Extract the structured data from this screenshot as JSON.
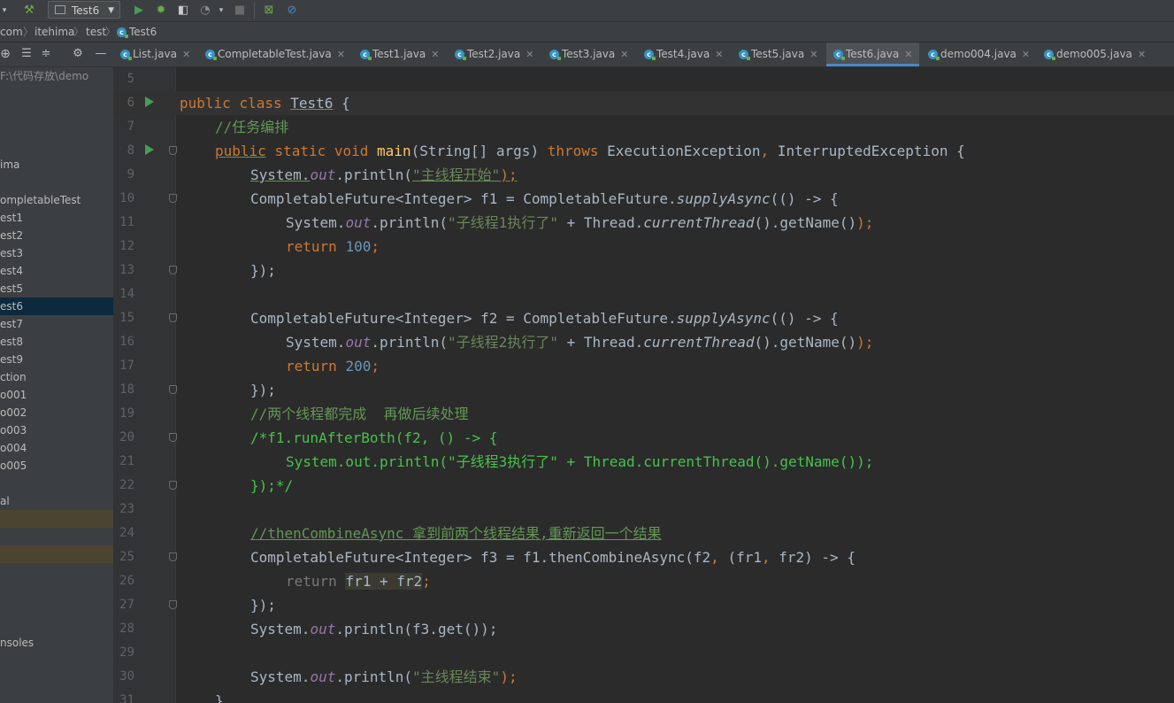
{
  "toolbar": {
    "run_config": "Test6"
  },
  "breadcrumb": [
    "com",
    "itehima",
    "test",
    "Test6"
  ],
  "tabs": [
    {
      "label": "List.java"
    },
    {
      "label": "CompletableTest.java"
    },
    {
      "label": "Test1.java"
    },
    {
      "label": "Test2.java"
    },
    {
      "label": "Test3.java"
    },
    {
      "label": "Test4.java"
    },
    {
      "label": "Test5.java"
    },
    {
      "label": "Test6.java",
      "active": true
    },
    {
      "label": "demo004.java"
    },
    {
      "label": "demo005.java"
    }
  ],
  "sidebar": {
    "path": "F:\\代码存放\\demo",
    "items": [
      {
        "label": "ima"
      },
      {
        "label": "ompletableTest"
      },
      {
        "label": "est1"
      },
      {
        "label": "est2"
      },
      {
        "label": "est3"
      },
      {
        "label": "est4"
      },
      {
        "label": "est5"
      },
      {
        "label": "est6"
      },
      {
        "label": "est7"
      },
      {
        "label": "est8"
      },
      {
        "label": "est9"
      },
      {
        "label": "ction"
      },
      {
        "label": "o001"
      },
      {
        "label": "o002"
      },
      {
        "label": "o003"
      },
      {
        "label": "o004"
      },
      {
        "label": "o005"
      },
      {
        "label": "al"
      },
      {
        "label": ""
      },
      {
        "label": ""
      },
      {
        "label": "nsoles"
      }
    ]
  },
  "editor": {
    "line_numbers": [
      "5",
      "6",
      "7",
      "8",
      "9",
      "10",
      "11",
      "12",
      "13",
      "14",
      "15",
      "16",
      "17",
      "18",
      "19",
      "20",
      "21",
      "22",
      "23",
      "24",
      "25",
      "26",
      "27",
      "28",
      "29",
      "30",
      "31"
    ],
    "text": {
      "l6_public": "public",
      "l6_class": "class",
      "l6_name": "Test6",
      "l6_brace": " {",
      "l7_comment": "//任务编排",
      "l8_public": "public",
      "l8_static": "static",
      "l8_void": "void",
      "l8_main": "main",
      "l8_params": "(String[] args) ",
      "l8_throws": "throws",
      "l8_ex1": " ExecutionException",
      "l8_comma": ",",
      "l8_ex2": " InterruptedException {",
      "sys": "System.",
      "out": "out",
      "println": ".println(",
      "l9_str": "\"主线程开始\"",
      "close_semi": ");",
      "l10_decl": "CompletableFuture<Integer> f1 = CompletableFuture.",
      "supply": "supplyAsync",
      "lambda_open": "(() -> {",
      "l11_str": "\"子线程1执行了\"",
      "plus_thread": " + Thread.",
      "cur": "currentThread",
      "getname": "().getName()",
      "semi_close": ");",
      "ret": "return",
      "l12_num": "100",
      "semi": ";",
      "close_block": "});",
      "l15_decl": "CompletableFuture<Integer> f2 = CompletableFuture.",
      "l16_str": "\"子线程2执行了\"",
      "l17_num": "200",
      "l19_comment": "//两个线程都完成  再做后续处理",
      "l20_comment": "/*f1.runAfterBoth(f2, () -> {",
      "l21_comment": "System.out.println(\"子线程3执行了\" + Thread.currentThread().getName());",
      "l22_comment": "});*/",
      "l24_comment": "//thenCombineAsync 拿到前两个线程结果,重新返回一个结果",
      "l25_decl": "CompletableFuture<Integer> f3 = f1.thenCombineAsync(f2",
      "l25_rest": " (fr1",
      "l25_rest2": " fr2) -> {",
      "l26_expr": "fr1 + fr2",
      "l28_call": "(f3.get());",
      "l30_str": "\"主线程结束\"",
      "l31": "}"
    }
  },
  "colors": {
    "keyword": "#cc7832",
    "string": "#6a8759",
    "comment": "#629755",
    "number": "#6897bb",
    "method": "#ffc66d",
    "field": "#9876aa",
    "accent": "#4a88c7"
  }
}
